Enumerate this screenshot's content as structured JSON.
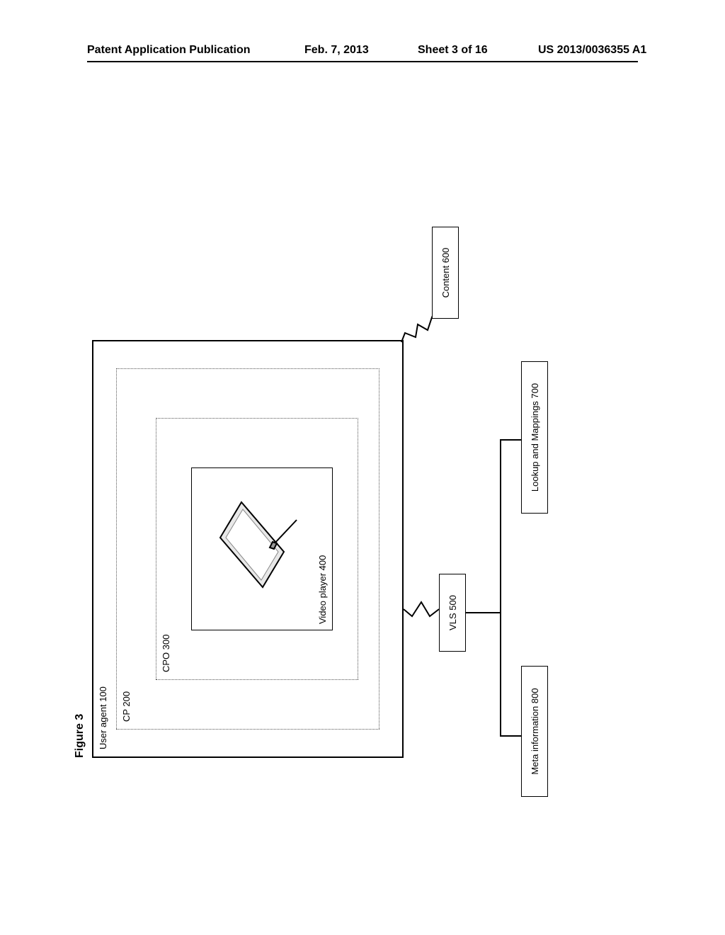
{
  "header": {
    "publication_type": "Patent Application Publication",
    "publication_date": "Feb. 7, 2013",
    "sheet": "Sheet 3 of 16",
    "publication_number": "US 2013/0036355 A1"
  },
  "figure": {
    "title": "Figure 3",
    "boxes": {
      "user_agent": "User agent 100",
      "cp": "CP 200",
      "cpo": "CPO 300",
      "video_player": "Video player 400",
      "vls": "VLS 500",
      "content": "Content 600",
      "lookup_mappings": "Lookup and Mappings 700",
      "meta_information": "Meta information 800"
    }
  }
}
